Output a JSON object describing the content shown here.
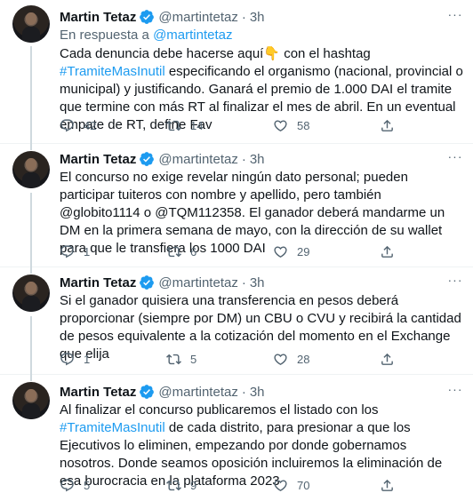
{
  "tweets": [
    {
      "name": "Martin Tetaz",
      "handle": "@martintetaz",
      "sep": "·",
      "time": "3h",
      "reply_prefix": "En respuesta a ",
      "reply_handle": "@martintetaz",
      "text_parts": [
        "Cada denuncia debe hacerse aquí👇 con el hashtag ",
        "#TramiteMasInutil",
        " especificando el organismo (nacional, provincial o municipal) y justificando. Ganará el premio de 1.000 DAI el tramite que termine con más RT al finalizar el mes de abril. En un eventual empate de RT, define Fav"
      ],
      "replies": "42",
      "retweets": "14",
      "likes": "58"
    },
    {
      "name": "Martin Tetaz",
      "handle": "@martintetaz",
      "sep": "·",
      "time": "3h",
      "text": "El concurso no exige revelar ningún dato personal; pueden participar tuiteros con nombre y apellido, pero también @globito1114 o @TQM112358. El ganador deberá mandarme un DM en la primera semana de mayo, con la dirección de su wallet para que le transfiera los 1000 DAI",
      "replies": "1",
      "retweets": "6",
      "likes": "29"
    },
    {
      "name": "Martin Tetaz",
      "handle": "@martintetaz",
      "sep": "·",
      "time": "3h",
      "text": "Si el ganador quisiera una transferencia en pesos deberá proporcionar (siempre por DM) un CBU o CVU y recibirá la cantidad de pesos equivalente a la cotización del momento en el Exchange que elija",
      "replies": "1",
      "retweets": "5",
      "likes": "28"
    },
    {
      "name": "Martin Tetaz",
      "handle": "@martintetaz",
      "sep": "·",
      "time": "3h",
      "text_parts": [
        "Al finalizar el concurso publicaremos el listado con los ",
        "#TramiteMasInutil",
        " de cada distrito, para presionar a que los Ejecutivos lo eliminen, empezando por donde gobernamos nosotros. Donde seamos oposición incluiremos la eliminación de esa burocracia en la plataforma 2023"
      ],
      "replies": "5",
      "retweets": "9",
      "likes": "70"
    }
  ],
  "colors": {
    "accent": "#1d9bf0",
    "muted": "#536471",
    "text": "#0f1419"
  },
  "icons": [
    "verified-badge-icon",
    "more-icon",
    "reply-icon",
    "retweet-icon",
    "like-icon",
    "share-icon"
  ]
}
